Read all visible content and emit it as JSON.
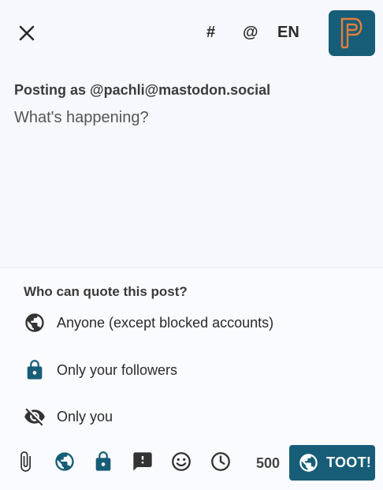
{
  "topbar": {
    "hashtag_label": "#",
    "mention_label": "@",
    "language_label": "EN"
  },
  "compose": {
    "posting_as": "Posting as @pachli@mastodon.social",
    "placeholder": "What's happening?",
    "value": ""
  },
  "quote_sheet": {
    "title": "Who can quote this post?",
    "options": [
      {
        "label": "Anyone (except blocked accounts)",
        "icon": "globe-icon"
      },
      {
        "label": "Only your followers",
        "icon": "lock-icon"
      },
      {
        "label": "Only you",
        "icon": "eye-off-icon"
      }
    ]
  },
  "toolbar": {
    "char_count": "500",
    "toot_label": "TOOT!"
  },
  "colors": {
    "accent": "#175d78",
    "logo_orange": "#e67e3b",
    "background": "#f6f8fd"
  }
}
